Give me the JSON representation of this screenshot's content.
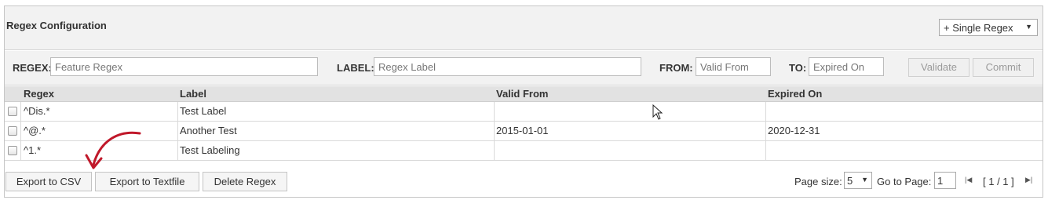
{
  "header": {
    "title": "Regex Configuration",
    "mode_select": "+ Single Regex"
  },
  "form": {
    "regex_label": "REGEX:",
    "regex_placeholder": "Feature Regex",
    "label_label": "LABEL:",
    "label_placeholder": "Regex Label",
    "from_label": "FROM:",
    "from_placeholder": "Valid From",
    "to_label": "TO:",
    "to_placeholder": "Expired On",
    "validate_label": "Validate",
    "commit_label": "Commit"
  },
  "grid": {
    "columns": [
      "Regex",
      "Label",
      "Valid From",
      "Expired On"
    ],
    "rows": [
      {
        "regex": "^Dis.*",
        "label": "Test Label",
        "valid_from": "",
        "expired_on": ""
      },
      {
        "regex": "^@.*",
        "label": "Another Test",
        "valid_from": "2015-01-01",
        "expired_on": "2020-12-31"
      },
      {
        "regex": "^1.*",
        "label": "Test Labeling",
        "valid_from": "",
        "expired_on": ""
      }
    ]
  },
  "footer": {
    "export_csv_label": "Export to CSV",
    "export_text_label": "Export to Textfile",
    "delete_label": "Delete Regex",
    "page_size_label": "Page size:",
    "page_size_value": "5",
    "goto_label": "Go to Page:",
    "goto_value": "1",
    "page_info": "[ 1 / 1 ]"
  },
  "colors": {
    "panel_bg": "#f2f2f2",
    "grid_header_bg": "#e2e2e2",
    "annotation_arrow": "#c0182a"
  }
}
